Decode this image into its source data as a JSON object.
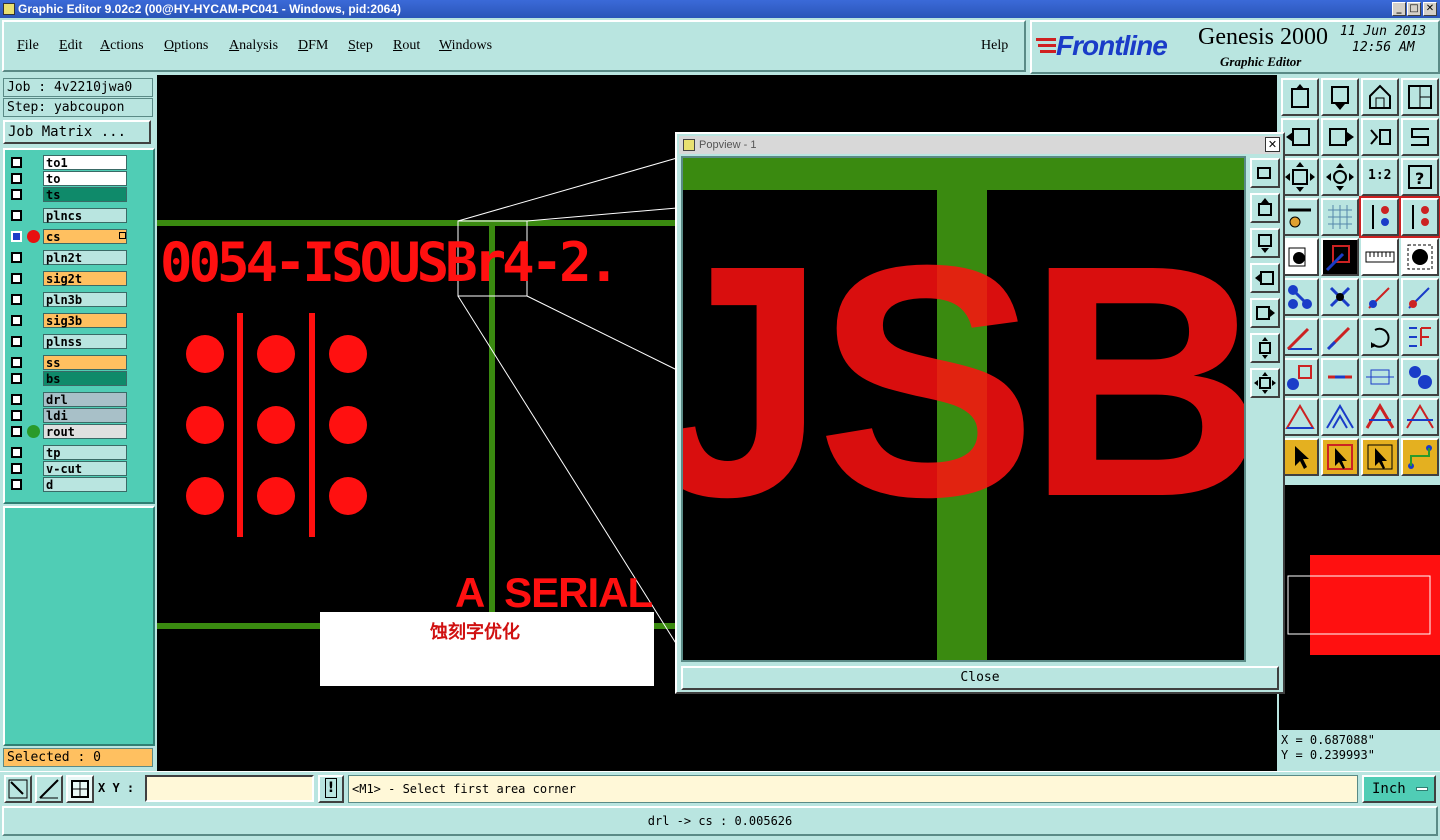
{
  "window": {
    "title": "Graphic Editor 9.02c2 (00@HY-HYCAM-PC041 - Windows, pid:2064)",
    "min_label": "_",
    "max_label": "□",
    "close_label": "✕"
  },
  "menubar": {
    "items": [
      "File",
      "Edit",
      "Actions",
      "Options",
      "Analysis",
      "DFM",
      "Step",
      "Rout",
      "Windows"
    ],
    "help": "Help"
  },
  "brand": {
    "logo": "Frontline",
    "product": "Genesis 2000",
    "subtitle": "Graphic Editor",
    "date": "11 Jun 2013",
    "time": "12:56 AM"
  },
  "left_panel": {
    "job": "Job : 4v2210jwa0",
    "step": "Step: yabcoupon",
    "job_matrix_button": "Job Matrix ...",
    "selected": "Selected : 0"
  },
  "layers": [
    {
      "name": "to1",
      "color": "#ffffff"
    },
    {
      "name": "to",
      "color": "#ffffff"
    },
    {
      "name": "ts",
      "color": "#0f8a6a"
    },
    {
      "name": "plncs",
      "color": "#b9e5e0"
    },
    {
      "name": "cs",
      "color": "#ffc060"
    },
    {
      "name": "pln2t",
      "color": "#b9e5e0"
    },
    {
      "name": "sig2t",
      "color": "#ffc060"
    },
    {
      "name": "pln3b",
      "color": "#b9e5e0"
    },
    {
      "name": "sig3b",
      "color": "#ffc060"
    },
    {
      "name": "plnss",
      "color": "#b9e5e0"
    },
    {
      "name": "ss",
      "color": "#ffc060"
    },
    {
      "name": "bs",
      "color": "#0f8a6a"
    },
    {
      "name": "drl",
      "color": "#a8c0c8"
    },
    {
      "name": "ldi",
      "color": "#a8c0c8"
    },
    {
      "name": "rout",
      "color": "#e0e0e0"
    },
    {
      "name": "tp",
      "color": "#b9e5e0"
    },
    {
      "name": "v-cut",
      "color": "#b9e5e0"
    },
    {
      "name": "d",
      "color": "#b9e5e0"
    }
  ],
  "canvas": {
    "board_text": "0054-ISOUSBr4-2.",
    "serial_text": "A  SERIAL",
    "annotation": "蚀刻字优化",
    "trace_color": "#3a8a10",
    "copper_color": "#ff1010"
  },
  "popview": {
    "title": "Popview - 1",
    "close_x": "✕",
    "zoom_text": "JSB",
    "close_button": "Close"
  },
  "coords": {
    "x": "X = 0.687088\"",
    "y": "Y = 0.239993\""
  },
  "bottom": {
    "xy_label": "X Y :",
    "xy_value": "",
    "alert": "!",
    "prompt": "<M1> - Select first area corner",
    "units": "Inch",
    "status": "drl -> cs : 0.005626"
  }
}
